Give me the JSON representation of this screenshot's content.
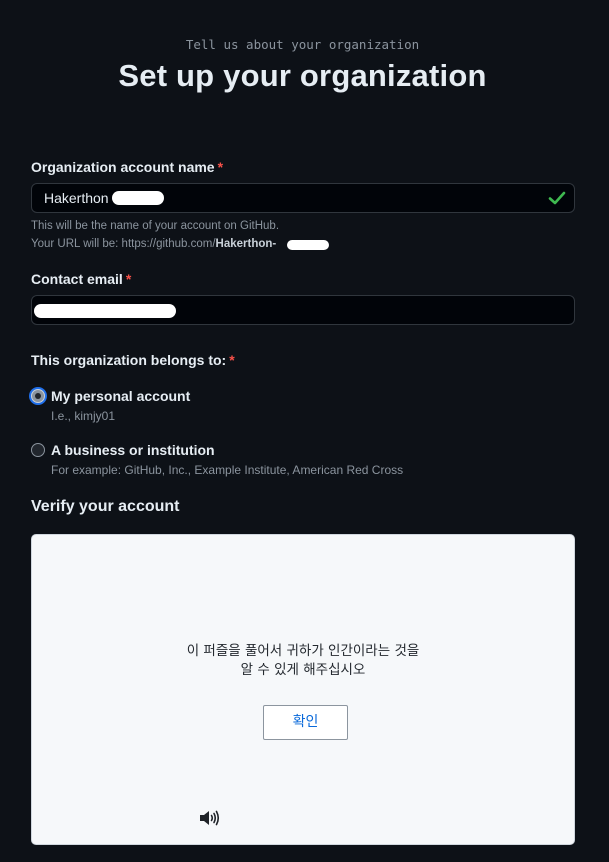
{
  "header": {
    "subtitle": "Tell us about your organization",
    "title": "Set up your organization"
  },
  "org_name": {
    "label": "Organization account name",
    "required_mark": "*",
    "value": "Hakerthon",
    "note_line1": "This will be the name of your account on GitHub.",
    "note_url_prefix": "Your URL will be: https://github.com/",
    "note_url_name": "Hakerthon-"
  },
  "contact_email": {
    "label": "Contact email",
    "required_mark": "*",
    "value": ""
  },
  "belongs_to": {
    "label": "This organization belongs to:",
    "required_mark": "*",
    "options": [
      {
        "label": "My personal account",
        "hint": "I.e., kimjy01",
        "checked": true
      },
      {
        "label": "A business or institution",
        "hint": "For example: GitHub, Inc., Example Institute, American Red Cross",
        "checked": false
      }
    ]
  },
  "verify": {
    "title": "Verify your account",
    "captcha_line1": "이 퍼즐을 풀어서 귀하가 인간이라는 것을",
    "captcha_line2": "알 수 있게 해주십시오",
    "button_label": "확인",
    "audio_icon": "speaker-icon"
  },
  "colors": {
    "background": "#0d1117",
    "required": "#f85149",
    "valid_check": "#3fb950",
    "focus_ring": "#1f6feb",
    "captcha_link": "#0969da"
  }
}
